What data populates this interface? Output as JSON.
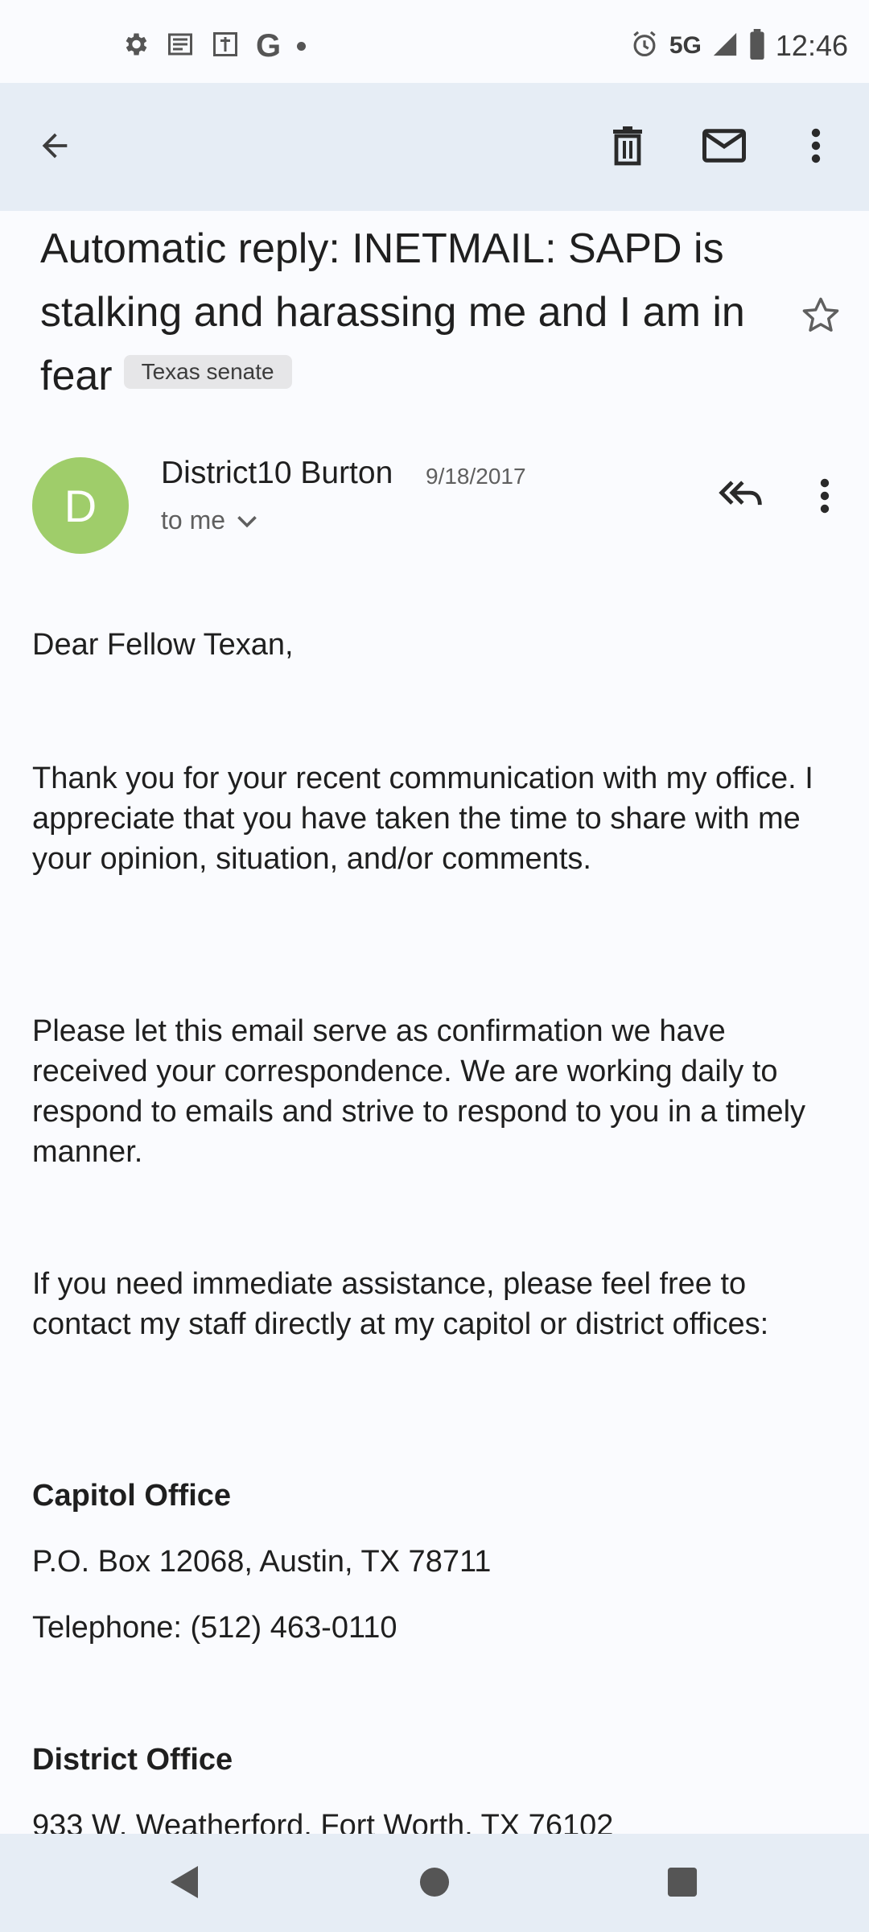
{
  "status_bar": {
    "time": "12:46",
    "network": "5G",
    "left_icons": [
      "settings-icon",
      "news-icon",
      "info-card-icon",
      "google-icon",
      "dot-icon"
    ],
    "google_letter": "G",
    "right_icons": [
      "alarm-icon",
      "signal-icon",
      "battery-icon"
    ]
  },
  "toolbar": {
    "back_icon": "arrow-left-icon",
    "delete_icon": "trash-icon",
    "mark_unread_icon": "mail-icon",
    "more_icon": "more-vert-icon"
  },
  "email": {
    "subject": "Automatic reply: INETMAIL: SAPD is stalking and harassing me and I am in fear",
    "label": "Texas senate",
    "starred": false,
    "sender": {
      "initial": "D",
      "name": "District10 Burton",
      "date": "9/18/2017",
      "recipient": "to me",
      "avatar_color": "#9fcd6a"
    },
    "body": {
      "greeting": "Dear Fellow Texan,",
      "p1": "Thank you for your recent communication with my office. I appreciate that you have taken the time to share with me your opinion, situation, and/or comments.",
      "p2": "Please let this email serve as confirmation we have received your correspondence. We are working daily to respond to emails and strive to respond to you in a timely manner.",
      "p3": "If you need immediate assistance, please feel free to contact my staff directly at my capitol or district offices:",
      "capitol_heading": "Capitol Office",
      "capitol_address": "P.O. Box 12068, Austin, TX 78711",
      "capitol_phone": "Telephone: (512) 463-0110",
      "district_heading": "District Office",
      "district_address": "933 W. Weatherford, Fort Worth, TX 76102"
    }
  },
  "nav_bar": {
    "back_icon": "nav-back-icon",
    "home_icon": "nav-home-icon",
    "recents_icon": "nav-recents-icon"
  },
  "colors": {
    "background": "#fafbfe",
    "toolbar": "#e6edf5",
    "text": "#1f1f1f",
    "secondary_text": "#5f5f5f",
    "label_chip": "#e6e6e8"
  }
}
